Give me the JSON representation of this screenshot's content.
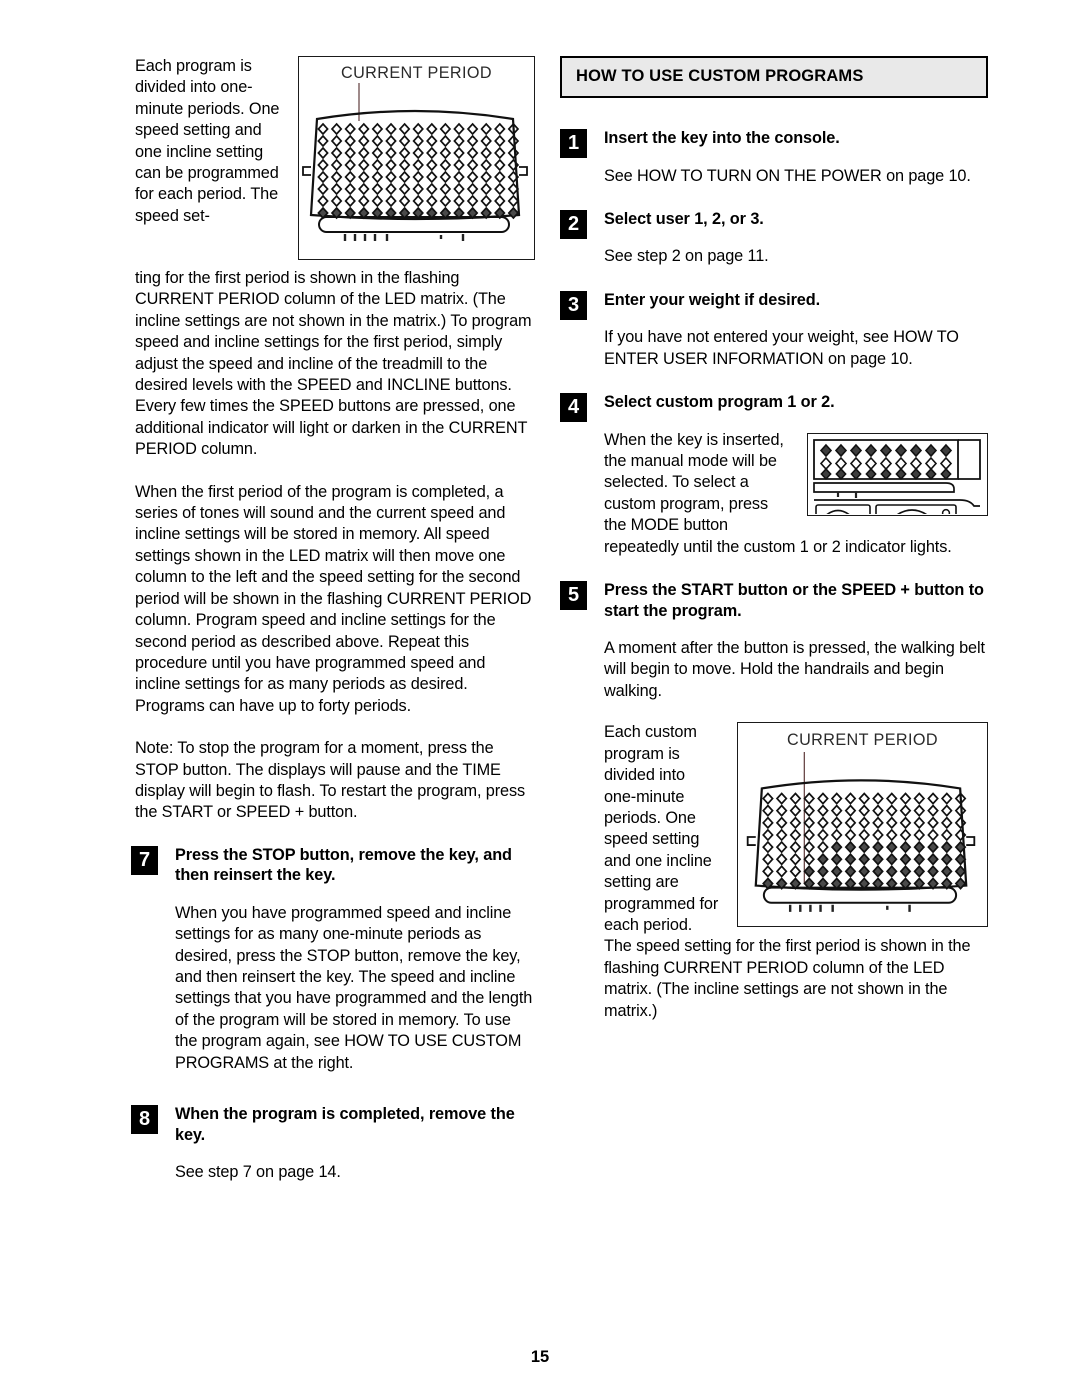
{
  "page": {
    "number": "15"
  },
  "left_column": {
    "intro_wrap": "Each program is divided into one-minute periods. One speed setting and one incline setting can be programmed for each period. The speed set-",
    "para_1_cont": "ting for the first period is shown in the flashing CURRENT PERIOD column of the LED matrix. (The incline settings are not shown in the matrix.) To program speed and incline settings for the first period, simply adjust the speed and incline of the treadmill to the desired levels with the SPEED and INCLINE buttons. Every few times the SPEED buttons are pressed, one additional indicator will light or darken in the CURRENT PERIOD column.",
    "para_2": "When the first period of the program is completed, a series of tones will sound and the current speed and incline settings will be stored in memory. All speed settings shown in the LED matrix will then move one column to the left and the speed setting for the second period will be shown in the flashing CURRENT PERIOD column. Program speed and incline settings for the second period as described above. Repeat this procedure until you have programmed speed and incline settings for as many periods as desired. Programs can have up to forty periods.",
    "para_3_note": "Note: To stop the program for a moment, press the STOP button. The displays will pause and the TIME display will begin to flash. To restart the program, press the START or SPEED + button.",
    "steps": [
      {
        "number": "7",
        "heading": "Press the STOP button, remove the key, and then reinsert the key.",
        "body": "When you have programmed speed and incline settings for as many one-minute periods as desired, press the STOP button, remove the key, and then reinsert the key. The speed and incline settings that you have programmed and the length of the program will be stored in memory. To use the program again, see HOW TO USE CUSTOM PROGRAMS at the right."
      },
      {
        "number": "8",
        "heading": "When the program is completed, remove the key.",
        "body": "See step 7 on page 14."
      }
    ]
  },
  "right_column": {
    "section_title": "HOW TO USE CUSTOM PROGRAMS",
    "steps": [
      {
        "number": "1",
        "heading": "Insert the key into the console.",
        "body": "See HOW TO TURN ON THE POWER on page 10."
      },
      {
        "number": "2",
        "heading": "Select user 1, 2, or 3.",
        "body": "See step 2 on page 11."
      },
      {
        "number": "3",
        "heading": "Enter your weight if desired.",
        "body": "If you have not entered your weight, see HOW TO ENTER USER INFORMATION on page 10."
      },
      {
        "number": "4",
        "heading": "Select custom program 1 or 2.",
        "body": "When the key is inserted, the manual mode will be selected. To select a custom program, press the MODE button repeatedly until the custom 1 or 2 indicator lights."
      },
      {
        "number": "5",
        "heading": "Press the START button or the SPEED + button to start the program.",
        "body": "A moment after the button is pressed, the walking belt will begin to move. Hold the handrails and begin walking.",
        "body_2": "Each custom program is divided into one-minute periods. One speed setting and one incline setting are programmed for each period. The speed setting for the first period is shown in the flashing CURRENT PERIOD column of the LED matrix. (The incline settings are not shown in the matrix.)"
      }
    ]
  },
  "diagrams": {
    "led_matrix_top": {
      "label": "CURRENT PERIOD",
      "columns": 15,
      "rows": 8
    },
    "console_crop": {
      "columns": 9,
      "rows": 3
    },
    "led_matrix_bottom": {
      "label": "CURRENT PERIOD",
      "columns": 15,
      "rows": 8
    }
  }
}
